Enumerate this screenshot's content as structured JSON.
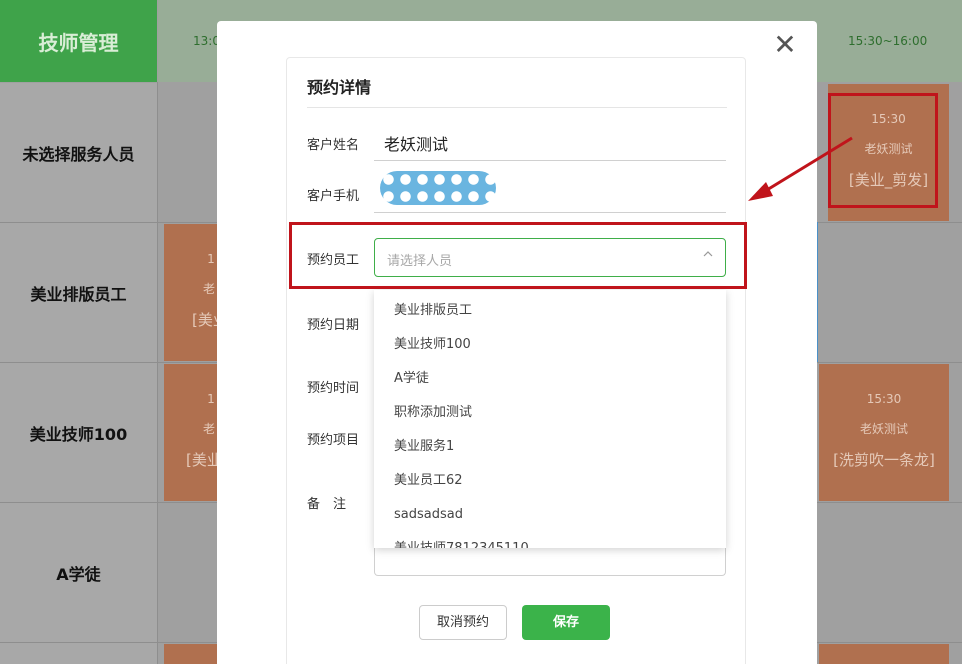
{
  "header": {
    "corner_title": "技师管理",
    "time_slots": [
      "13:0",
      "15:30~16:00"
    ]
  },
  "rows": [
    {
      "label": "未选择服务人员"
    },
    {
      "label": "美业排版员工"
    },
    {
      "label": "美业技师100"
    },
    {
      "label": "A学徒"
    }
  ],
  "appointments": [
    {
      "time": "15:30",
      "name": "老妖测试",
      "service": "[美业_剪发]"
    },
    {
      "time": "1",
      "name": "老",
      "service": "[美业"
    },
    {
      "time": "1",
      "name": "老",
      "service": "[美业_"
    },
    {
      "time": "15:30",
      "name": "老妖测试",
      "service": "[洗剪吹一条龙]"
    }
  ],
  "modal": {
    "title": "预约详情",
    "close_icon": "close-icon",
    "fields": {
      "customer_name_label": "客户姓名",
      "customer_name_value": "老妖测试",
      "customer_phone_label": "客户手机",
      "staff_label": "预约员工",
      "staff_placeholder": "请选择人员",
      "date_label": "预约日期",
      "time_label": "预约时间",
      "service_label": "预约项目",
      "remark_label": "备　注"
    },
    "staff_options": [
      "美业排版员工",
      "美业技师100",
      "A学徒",
      "职称添加测试",
      "美业服务1",
      "美业员工62",
      "sadsadsad",
      "美业技师7812345110"
    ],
    "buttons": {
      "cancel": "取消预约",
      "save": "保存"
    }
  },
  "colors": {
    "accent_green": "#3bb34a",
    "annotation_red": "#c0141b",
    "appointment": "#b0704f"
  }
}
